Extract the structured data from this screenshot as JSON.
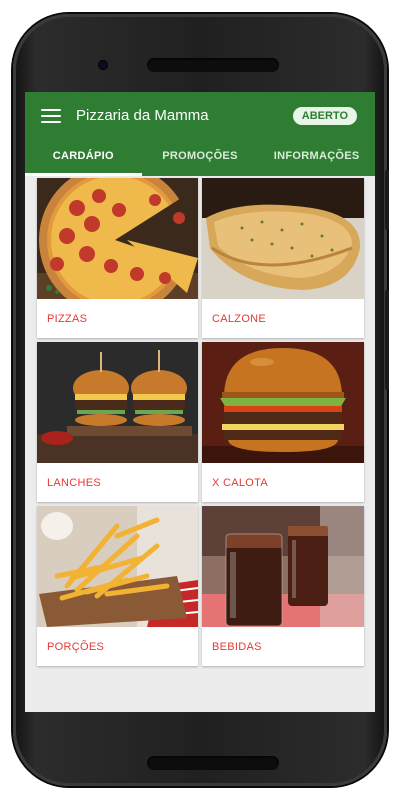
{
  "app": {
    "title": "Pizzaria da Mamma",
    "status": "ABERTO"
  },
  "tabs": [
    {
      "label": "CARDÁPIO",
      "active": true
    },
    {
      "label": "PROMOÇÕES",
      "active": false
    },
    {
      "label": "INFORMAÇÕES",
      "active": false
    }
  ],
  "categories": [
    {
      "label": "PIZZAS",
      "image": "pizza-photo"
    },
    {
      "label": "CALZONE",
      "image": "calzone-photo"
    },
    {
      "label": "LANCHES",
      "image": "burgers-photo"
    },
    {
      "label": "X CALOTA",
      "image": "big-burger-photo"
    },
    {
      "label": "PORÇÕES",
      "image": "fries-photo"
    },
    {
      "label": "BEBIDAS",
      "image": "soda-photo"
    }
  ],
  "colors": {
    "primary": "#2e7d32",
    "label": "#e53935",
    "background": "#ececec"
  }
}
